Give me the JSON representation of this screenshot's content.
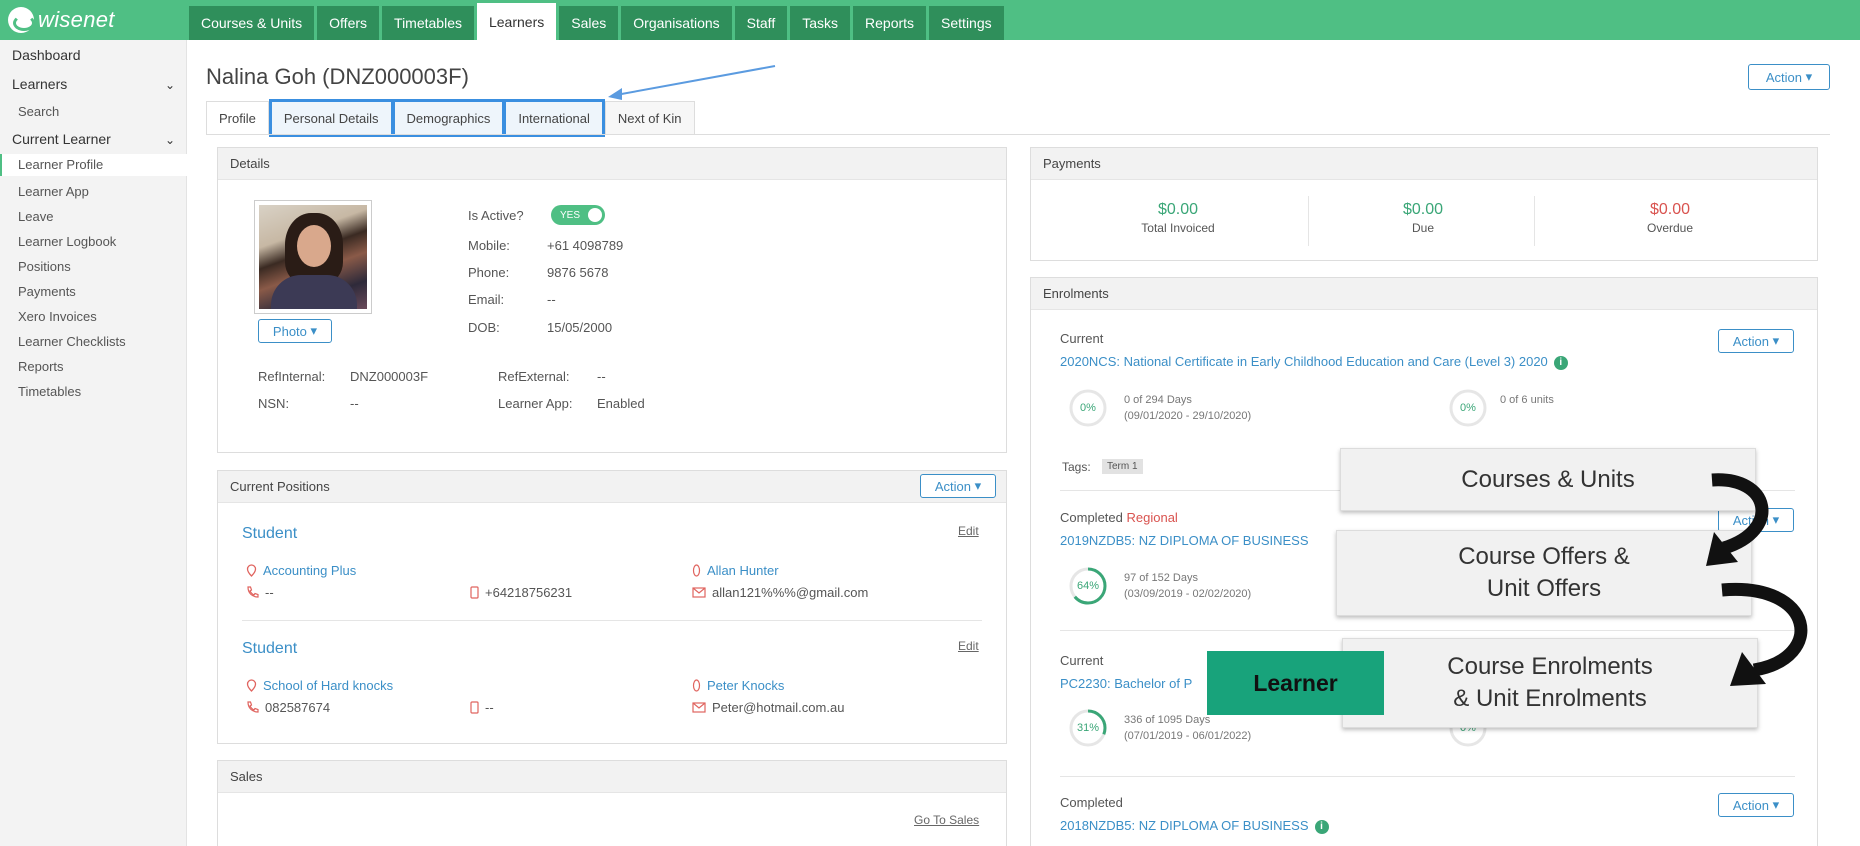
{
  "app": {
    "logo": "wisenet"
  },
  "nav": {
    "items": [
      {
        "label": "Courses & Units"
      },
      {
        "label": "Offers"
      },
      {
        "label": "Timetables"
      },
      {
        "label": "Learners",
        "active": true
      },
      {
        "label": "Sales"
      },
      {
        "label": "Organisations"
      },
      {
        "label": "Staff"
      },
      {
        "label": "Tasks"
      },
      {
        "label": "Reports"
      },
      {
        "label": "Settings"
      }
    ]
  },
  "sidebar": {
    "dashboard": "Dashboard",
    "learners": "Learners",
    "search": "Search",
    "current_learner": "Current Learner",
    "items": [
      {
        "label": "Learner Profile",
        "active": true
      },
      {
        "label": "Learner App"
      },
      {
        "label": "Leave"
      },
      {
        "label": "Learner Logbook"
      },
      {
        "label": "Positions"
      },
      {
        "label": "Payments"
      },
      {
        "label": "Xero Invoices"
      },
      {
        "label": "Learner Checklists"
      },
      {
        "label": "Reports"
      },
      {
        "label": "Timetables"
      }
    ]
  },
  "page": {
    "title": "Nalina Goh (DNZ000003F)",
    "action_label": "Action"
  },
  "tabs": [
    {
      "label": "Profile",
      "active": true
    },
    {
      "label": "Personal Details",
      "highlighted": true
    },
    {
      "label": "Demographics",
      "highlighted": true
    },
    {
      "label": "International",
      "highlighted": true
    },
    {
      "label": "Next of Kin"
    }
  ],
  "details": {
    "header": "Details",
    "photo_button": "Photo",
    "is_active_label": "Is Active?",
    "is_active_toggle": "YES",
    "mobile_label": "Mobile:",
    "mobile": "+61 4098789",
    "phone_label": "Phone:",
    "phone": "9876 5678",
    "email_label": "Email:",
    "email": "--",
    "dob_label": "DOB:",
    "dob": "15/05/2000",
    "ref_internal_label": "RefInternal:",
    "ref_internal": "DNZ000003F",
    "ref_external_label": "RefExternal:",
    "ref_external": "--",
    "nsn_label": "NSN:",
    "nsn": "--",
    "learner_app_label": "Learner App:",
    "learner_app": "Enabled"
  },
  "positions": {
    "header": "Current Positions",
    "action_label": "Action",
    "items": [
      {
        "title": "Student",
        "edit": "Edit",
        "organisation": "Accounting Plus",
        "phone": "--",
        "mobile": "+64218756231",
        "contact": "Allan Hunter",
        "email": "allan121%%%@gmail.com"
      },
      {
        "title": "Student",
        "edit": "Edit",
        "organisation": "School of Hard knocks",
        "phone": "082587674",
        "mobile": "--",
        "contact": "Peter Knocks",
        "email": "Peter@hotmail.com.au"
      }
    ]
  },
  "sales": {
    "header": "Sales",
    "link": "Go To Sales"
  },
  "payments": {
    "header": "Payments",
    "items": [
      {
        "amount": "$0.00",
        "label": "Total Invoiced"
      },
      {
        "amount": "$0.00",
        "label": "Due"
      },
      {
        "amount": "$0.00",
        "label": "Overdue"
      }
    ]
  },
  "enrolments": {
    "header": "Enrolments",
    "action_label": "Action",
    "items": [
      {
        "status": "Current",
        "course": "2020NCS: National Certificate in Early Childhood Education and Care (Level 3) 2020",
        "days_pct": "0%",
        "days_fraction": 0,
        "days": "0 of 294 Days",
        "range": "(09/01/2020 - 29/10/2020)",
        "units_pct": "0%",
        "units_fraction": 0,
        "units": "0 of 6 units",
        "tags_label": "Tags:",
        "tag": "Term 1"
      },
      {
        "status": "Completed",
        "status_extra": "Regional",
        "course": "2019NZDB5: NZ DIPLOMA OF BUSINESS",
        "days_pct": "64%",
        "days_fraction": 0.64,
        "days": "97 of 152 Days",
        "range": "(03/09/2019 - 02/02/2020)"
      },
      {
        "status": "Current",
        "course": "PC2230: Bachelor of P",
        "days_pct": "31%",
        "days_fraction": 0.31,
        "days": "336 of 1095 Days",
        "range": "(07/01/2019 - 06/01/2022)",
        "units_pct": "0%",
        "units_fraction": 0
      },
      {
        "status": "Completed",
        "course": "2018NZDB5: NZ DIPLOMA OF BUSINESS"
      }
    ]
  },
  "overlay": {
    "box1": "Courses & Units",
    "box2_line1": "Course Offers &",
    "box2_line2": "Unit Offers",
    "box3_line1": "Course Enrolments",
    "box3_line2": "& Unit Enrolments",
    "learner": "Learner"
  },
  "colors": {
    "brand": "#4fbf84",
    "nav_dark": "#2f8f5b",
    "link": "#3b8fc7",
    "highlight": "#3a8fe0",
    "learner_box": "#18a37b",
    "overdue": "#d9534f"
  }
}
